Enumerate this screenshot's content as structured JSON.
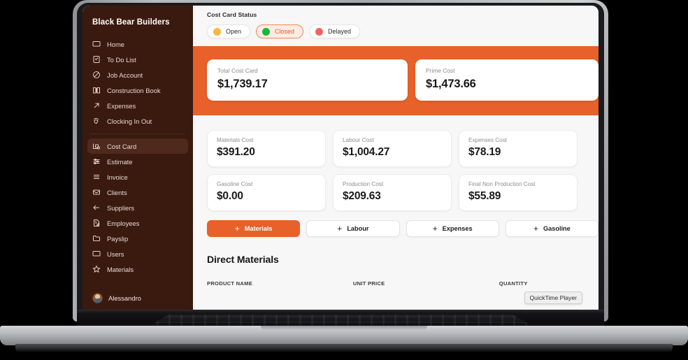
{
  "sidebar": {
    "brand": "Black Bear Builders",
    "items": [
      {
        "label": "Home",
        "icon": "monitor-icon",
        "active": false
      },
      {
        "label": "To Do List",
        "icon": "clipboard-check-icon",
        "active": false
      },
      {
        "label": "Job Account",
        "icon": "slash-circle-icon",
        "active": false
      },
      {
        "label": "Construction Book",
        "icon": "book-open-icon",
        "active": false
      },
      {
        "label": "Expenses",
        "icon": "arrow-up-right-icon",
        "active": false
      },
      {
        "label": "Clocking In Out",
        "icon": "hand-wave-icon",
        "active": false
      },
      {
        "label": "Cost Card",
        "icon": "cost-card-icon",
        "active": true
      },
      {
        "label": "Estimate",
        "icon": "sliders-icon",
        "active": false
      },
      {
        "label": "Invoice",
        "icon": "list-lines-icon",
        "active": false
      },
      {
        "label": "Clients",
        "icon": "envelope-icon",
        "active": false
      },
      {
        "label": "Suppliers",
        "icon": "arrow-left-icon",
        "active": false
      },
      {
        "label": "Employees",
        "icon": "file-edit-icon",
        "active": false
      },
      {
        "label": "Payslip",
        "icon": "folder-icon",
        "active": false
      },
      {
        "label": "Users",
        "icon": "monitor-icon",
        "active": false
      },
      {
        "label": "Materials",
        "icon": "star-icon",
        "active": false
      }
    ],
    "footer": {
      "user_name": "Alessandro",
      "avatar": "avatar"
    }
  },
  "main": {
    "status_section": {
      "label": "Cost Card Status",
      "pills": [
        {
          "label": "Open",
          "dot_color": "#f5b841",
          "selected": false
        },
        {
          "label": "Closed",
          "dot_color": "#18b83a",
          "selected": true
        },
        {
          "label": "Delayed",
          "dot_color": "#f4645c",
          "selected": false
        }
      ]
    },
    "band_kpis": [
      {
        "label": "Total Cost Card",
        "value": "$1,739.17"
      },
      {
        "label": "Prime Cost",
        "value": "$1,473.66"
      }
    ],
    "cards": [
      {
        "label": "Materials Cost",
        "value": "$391.20"
      },
      {
        "label": "Labour Cost",
        "value": "$1,004.27"
      },
      {
        "label": "Expenses Cost",
        "value": "$78.19"
      },
      {
        "label": "Gasoline Cost",
        "value": "$0.00"
      },
      {
        "label": "Production Cost",
        "value": "$209.63"
      },
      {
        "label": "Final Non Production Cost",
        "value": "$55.89"
      }
    ],
    "actions": [
      {
        "label": "Materials",
        "icon": "plus-icon",
        "primary": true
      },
      {
        "label": "Labour",
        "icon": "plus-icon",
        "primary": false
      },
      {
        "label": "Expenses",
        "icon": "plus-icon",
        "primary": false
      },
      {
        "label": "Gasoline",
        "icon": "plus-icon",
        "primary": false
      }
    ],
    "table": {
      "section_title": "Direct Materials",
      "columns": [
        "PRODUCT NAME",
        "UNIT PRICE",
        "QUANTITY"
      ]
    },
    "tooltip": "QuickTime Player"
  },
  "theme": {
    "accent": "#e8602a",
    "sidebar_bg": "#3a1a0f",
    "sidebar_active_bg": "#4e291c",
    "content_bg": "#f7f7f7",
    "card_bg": "#ffffff",
    "selected_pill_bg": "#fdece4",
    "selected_pill_text": "#e8572a"
  }
}
